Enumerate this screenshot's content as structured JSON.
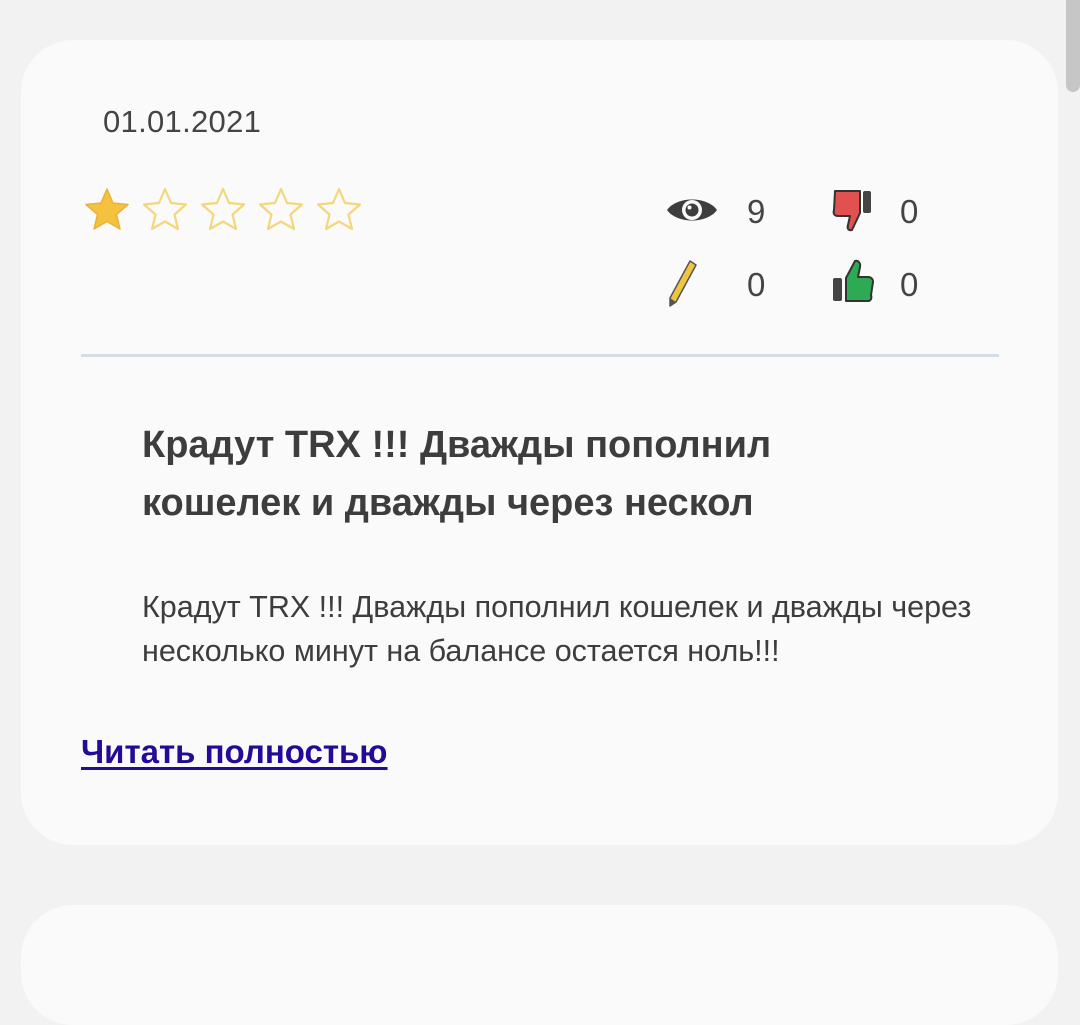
{
  "review": {
    "date": "01.01.2021",
    "rating": 1,
    "rating_max": 5,
    "stats": {
      "views": "9",
      "comments": "0",
      "dislikes": "0",
      "likes": "0"
    },
    "title": "Крадут TRX !!! Дважды пополнил кошелек и дважды через нескол",
    "excerpt": "Крадут TRX !!! Дважды пополнил кошелек и дважды через несколько минут на балансе остается ноль!!!",
    "read_more_label": "Читать полностью"
  },
  "colors": {
    "star_filled": "#f5c23f",
    "star_empty_outline": "#f3d77a",
    "dislike": "#e0514f",
    "like": "#2eaa55",
    "pencil": "#f2c443",
    "link": "#240a96",
    "divider": "#d5dee7"
  },
  "icons": {
    "views": "eye-icon",
    "comments": "pencil-icon",
    "dislikes": "thumbs-down-icon",
    "likes": "thumbs-up-icon",
    "rating": "star-icon"
  }
}
